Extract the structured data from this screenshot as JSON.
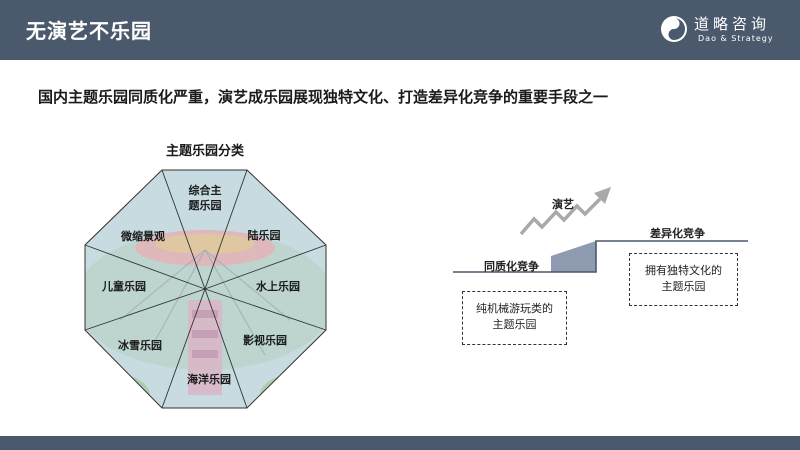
{
  "header": {
    "title": "无演艺不乐园",
    "logo_cn": "道略咨询",
    "logo_en": "Dao & Strategy"
  },
  "subtitle": "国内主题乐园同质化严重，演艺成乐园展现独特文化、打造差异化竞争的重要手段之一",
  "classification": {
    "title": "主题乐园分类",
    "segments": {
      "comprehensive": [
        "综合主",
        "题乐园"
      ],
      "land": "陆乐园",
      "water": "水上乐园",
      "film": "影视乐园",
      "ocean": "海洋乐园",
      "snow": "冰雪乐园",
      "children": "儿童乐园",
      "miniature": "微缩景观"
    }
  },
  "competition": {
    "performance_label": "演艺",
    "homogeneous_label": "同质化竞争",
    "differentiated_label": "差异化竞争",
    "homogeneous_box": [
      "纯机械游玩类的",
      "主题乐园"
    ],
    "differentiated_box": [
      "拥有独特文化的",
      "主题乐园"
    ]
  },
  "colors": {
    "header_bg": "#4a596b",
    "accent": "#8e9bb0"
  }
}
